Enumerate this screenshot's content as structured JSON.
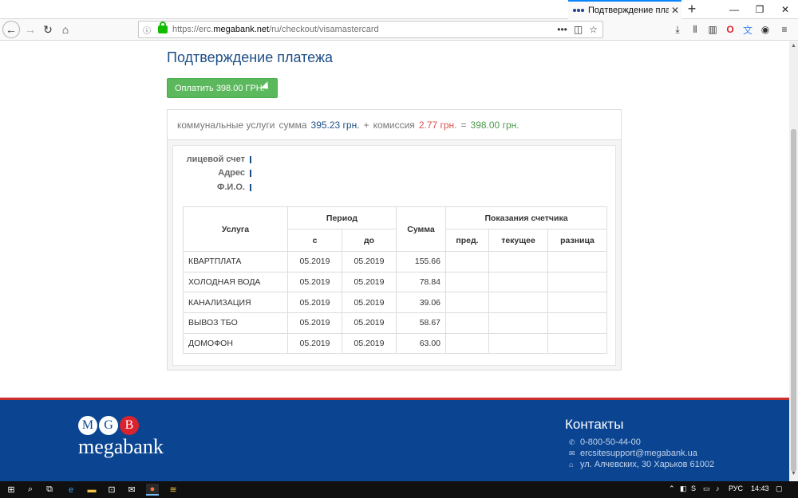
{
  "browser": {
    "tab_title": "Подтверждение платежа |",
    "tab_close": "✕",
    "new_tab": "+",
    "url_scheme": "https://erc.",
    "url_domain": "megabank.net",
    "url_path": "/ru/checkout/visamastercard",
    "window_buttons": [
      "—",
      "❐",
      "✕"
    ]
  },
  "page": {
    "title": "Подтверждение платежа",
    "pay_button": "Оплатить 398.00 ГРН.",
    "summary": {
      "label": "коммунальные услуги",
      "sum_label": "сумма",
      "sum_value": "395.23 грн.",
      "plus": "+",
      "fee_label": "комиссия",
      "fee_value": "2.77 грн.",
      "equals": "=",
      "total_value": "398.00 грн."
    },
    "info": {
      "account_label": "лицевой счет",
      "address_label": "Адрес",
      "name_label": "Ф.И.О."
    },
    "table": {
      "headers": {
        "service": "Услуга",
        "period": "Период",
        "from": "с",
        "to": "до",
        "sum": "Сумма",
        "meter": "Показания счетчика",
        "prev": "пред.",
        "current": "текущее",
        "diff": "разница"
      },
      "rows": [
        {
          "service": "КВАРТПЛАТА",
          "from": "05.2019",
          "to": "05.2019",
          "sum": "155.66"
        },
        {
          "service": "ХОЛОДНАЯ ВОДА",
          "from": "05.2019",
          "to": "05.2019",
          "sum": "78.84"
        },
        {
          "service": "КАНАЛИЗАЦИЯ",
          "from": "05.2019",
          "to": "05.2019",
          "sum": "39.06"
        },
        {
          "service": "ВЫВОЗ ТБО",
          "from": "05.2019",
          "to": "05.2019",
          "sum": "58.67"
        },
        {
          "service": "ДОМОФОН",
          "from": "05.2019",
          "to": "05.2019",
          "sum": "63.00"
        }
      ]
    }
  },
  "footer": {
    "logo_letters": [
      "M",
      "G",
      "B"
    ],
    "logo_word": "megabank",
    "contacts_title": "Контакты",
    "phone": "0-800-50-44-00",
    "email": "ercsitesupport@megabank.ua",
    "address": "ул. Алчевских, 30 Харьков 61002"
  },
  "taskbar": {
    "language": "РУС",
    "time": "14:43"
  },
  "colors": {
    "accent_blue": "#1d4f87",
    "pay_green": "#5cb85c",
    "fee_red": "#d9534f",
    "footer_blue": "#0b4591"
  }
}
